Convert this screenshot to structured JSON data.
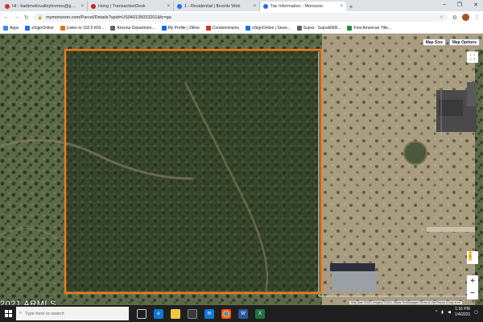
{
  "tabs": [
    {
      "title": "HI - barbmeli​svalleyhomes@gm...",
      "color": "#d93025",
      "active": false
    },
    {
      "title": "Hong | TransactionDesk",
      "color": "#c5221f",
      "active": false
    },
    {
      "title": "1 - Residential | flexmls Web",
      "color": "#1a73e8",
      "active": false
    },
    {
      "title": "Tax Information - Monsoon",
      "color": "#1a73e8",
      "active": true
    }
  ],
  "address": {
    "url": "mymonsoon.com/Parcel/Details?upid=US040135033201&fc=ga"
  },
  "bookmarks": [
    {
      "label": "Apps",
      "color": "#4285f4"
    },
    {
      "label": "eSignOnline",
      "color": "#1a73e8"
    },
    {
      "label": "Listen to 102.5 KNI...",
      "color": "#e37400"
    },
    {
      "label": "Arizona Departmen...",
      "color": "#5f6368"
    },
    {
      "label": "My Profile | Zillow",
      "color": "#006aff"
    },
    {
      "label": "Condominiums",
      "color": "#d93025"
    },
    {
      "label": "eSignOnline | Sessi...",
      "color": "#1a73e8"
    },
    {
      "label": "Supra - SupraWEB...",
      "color": "#5f6368"
    },
    {
      "label": "First American Title...",
      "color": "#1e8e3e"
    }
  ],
  "map": {
    "map_size_label": "Map Size",
    "map_options_label": "Map Options",
    "attribution": "Map data ©2021 Imagery ©2021, Maxar Technologies  Terms of Use  Report a map error",
    "parcel_color": "#ef7a1d"
  },
  "watermark": "2021 ARMLS",
  "taskbar": {
    "search_placeholder": "Type here to search",
    "time": "1:16 PM",
    "date": "1/4/2021"
  }
}
